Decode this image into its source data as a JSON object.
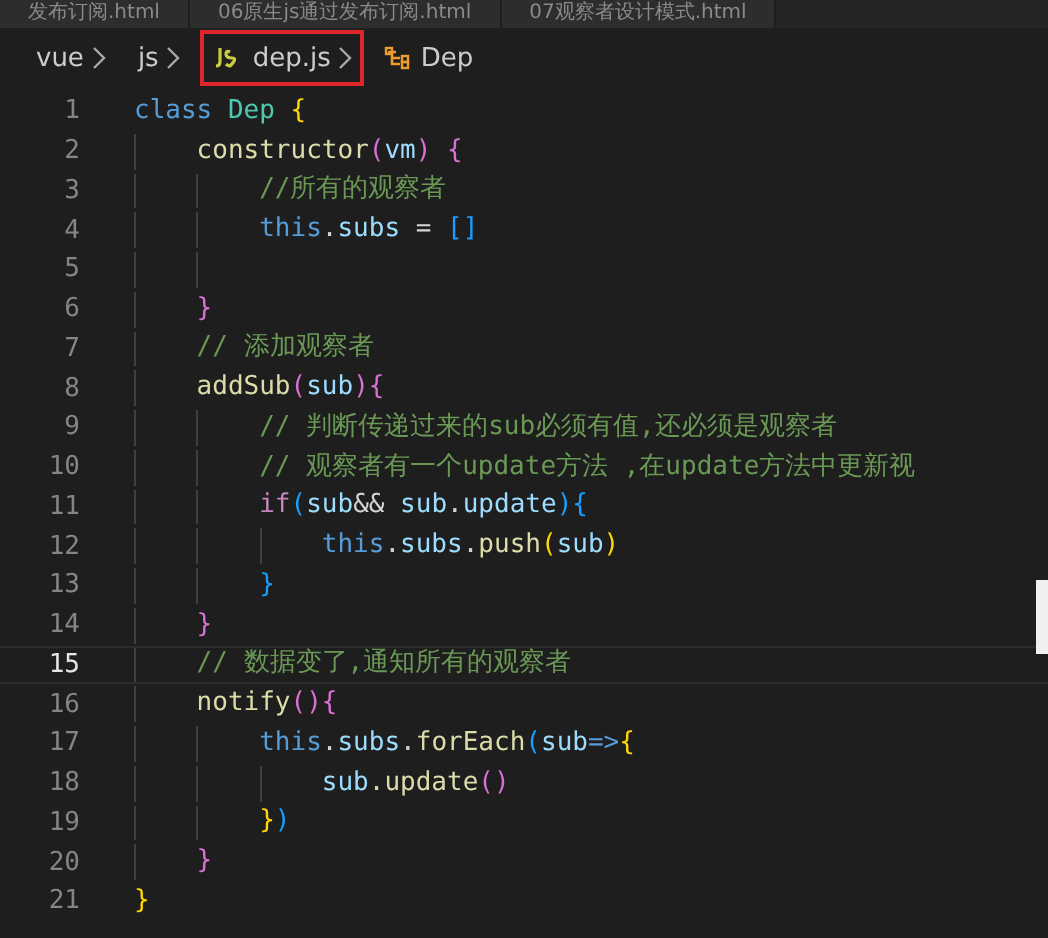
{
  "tabs": [
    {
      "label": "发布订阅.html",
      "selected": false
    },
    {
      "label": "06原生js通过发布订阅.html",
      "selected": false
    },
    {
      "label": "07观察者设计模式.html",
      "selected": false
    }
  ],
  "breadcrumb": [
    {
      "label": "vue",
      "kind": "folder",
      "highlighted": false
    },
    {
      "label": "js",
      "kind": "folder",
      "highlighted": false
    },
    {
      "label": "dep.js",
      "kind": "file",
      "highlighted": true
    },
    {
      "label": "Dep",
      "kind": "symbol",
      "highlighted": false
    }
  ],
  "lines": [
    {
      "number": "1",
      "current": false,
      "tokens": [
        {
          "text": "class ",
          "kind": "kw"
        },
        {
          "text": "Dep ",
          "kind": "cls"
        },
        {
          "text": "{",
          "kind": "b1"
        }
      ]
    },
    {
      "number": "2",
      "current": false,
      "tokens": [
        {
          "text": "    constructor",
          "kind": "fn"
        },
        {
          "text": "(",
          "kind": "b2"
        },
        {
          "text": "vm",
          "kind": "var"
        },
        {
          "text": ") {",
          "kind": "b2"
        }
      ]
    },
    {
      "number": "3",
      "current": false,
      "tokens": [
        {
          "text": "        //所有的观察者",
          "kind": "cm"
        }
      ]
    },
    {
      "number": "4",
      "current": false,
      "tokens": [
        {
          "text": "        this",
          "kind": "kw"
        },
        {
          "text": ".",
          "kind": "op"
        },
        {
          "text": "subs",
          "kind": "var"
        },
        {
          "text": " = ",
          "kind": "op"
        },
        {
          "text": "[]",
          "kind": "b3"
        }
      ]
    },
    {
      "number": "5",
      "current": false
    },
    {
      "number": "6",
      "current": false,
      "tokens": [
        {
          "text": "    }",
          "kind": "b2"
        }
      ]
    },
    {
      "number": "7",
      "current": false,
      "tokens": [
        {
          "text": "    // 添加观察者",
          "kind": "cm"
        }
      ]
    },
    {
      "number": "8",
      "current": false,
      "tokens": [
        {
          "text": "    addSub",
          "kind": "fn"
        },
        {
          "text": "(",
          "kind": "b2"
        },
        {
          "text": "sub",
          "kind": "var"
        },
        {
          "text": "){",
          "kind": "b2"
        }
      ]
    },
    {
      "number": "9",
      "current": false,
      "tokens": [
        {
          "text": "        // 判断传递过来的sub必须有值,还必须是观察者",
          "kind": "cm"
        }
      ]
    },
    {
      "number": "10",
      "current": false,
      "tokens": [
        {
          "text": "        // 观察者有一个update方法 ,在update方法中更新视",
          "kind": "cm"
        }
      ]
    },
    {
      "number": "11",
      "current": false,
      "tokens": [
        {
          "text": "        if",
          "kind": "ctl"
        },
        {
          "text": "(",
          "kind": "b3"
        },
        {
          "text": "sub",
          "kind": "var"
        },
        {
          "text": "&& ",
          "kind": "op"
        },
        {
          "text": "sub",
          "kind": "var"
        },
        {
          "text": ".",
          "kind": "op"
        },
        {
          "text": "update",
          "kind": "var"
        },
        {
          "text": "){",
          "kind": "b3"
        }
      ]
    },
    {
      "number": "12",
      "current": false,
      "tokens": [
        {
          "text": "            this",
          "kind": "kw"
        },
        {
          "text": ".",
          "kind": "op"
        },
        {
          "text": "subs",
          "kind": "var"
        },
        {
          "text": ".",
          "kind": "op"
        },
        {
          "text": "push",
          "kind": "fn"
        },
        {
          "text": "(",
          "kind": "b1"
        },
        {
          "text": "sub",
          "kind": "var"
        },
        {
          "text": ")",
          "kind": "b1"
        }
      ]
    },
    {
      "number": "13",
      "current": false,
      "tokens": [
        {
          "text": "        }",
          "kind": "b3"
        }
      ]
    },
    {
      "number": "14",
      "current": false,
      "tokens": [
        {
          "text": "    }",
          "kind": "b2"
        }
      ]
    },
    {
      "number": "15",
      "current": true,
      "tokens": [
        {
          "text": "    // 数据变了,通知所有的观察者",
          "kind": "cm"
        }
      ]
    },
    {
      "number": "16",
      "current": false,
      "tokens": [
        {
          "text": "    notify",
          "kind": "fn"
        },
        {
          "text": "(){",
          "kind": "b2"
        }
      ]
    },
    {
      "number": "17",
      "current": false,
      "tokens": [
        {
          "text": "        this",
          "kind": "kw"
        },
        {
          "text": ".",
          "kind": "op"
        },
        {
          "text": "subs",
          "kind": "var"
        },
        {
          "text": ".",
          "kind": "op"
        },
        {
          "text": "forEach",
          "kind": "fn"
        },
        {
          "text": "(",
          "kind": "b3"
        },
        {
          "text": "sub",
          "kind": "var"
        },
        {
          "text": "=>",
          "kind": "kw"
        },
        {
          "text": "{",
          "kind": "b1"
        }
      ]
    },
    {
      "number": "18",
      "current": false,
      "tokens": [
        {
          "text": "            sub",
          "kind": "var"
        },
        {
          "text": ".update",
          "kind": "fn"
        },
        {
          "text": "()",
          "kind": "b2"
        }
      ]
    },
    {
      "number": "19",
      "current": false,
      "tokens": [
        {
          "text": "        }",
          "kind": "b1"
        },
        {
          "text": ")",
          "kind": "b3"
        }
      ]
    },
    {
      "number": "20",
      "current": false,
      "tokens": [
        {
          "text": "    }",
          "kind": "b2"
        }
      ]
    },
    {
      "number": "21",
      "current": false,
      "tokens": [
        {
          "text": "}",
          "kind": "b1"
        }
      ]
    }
  ]
}
